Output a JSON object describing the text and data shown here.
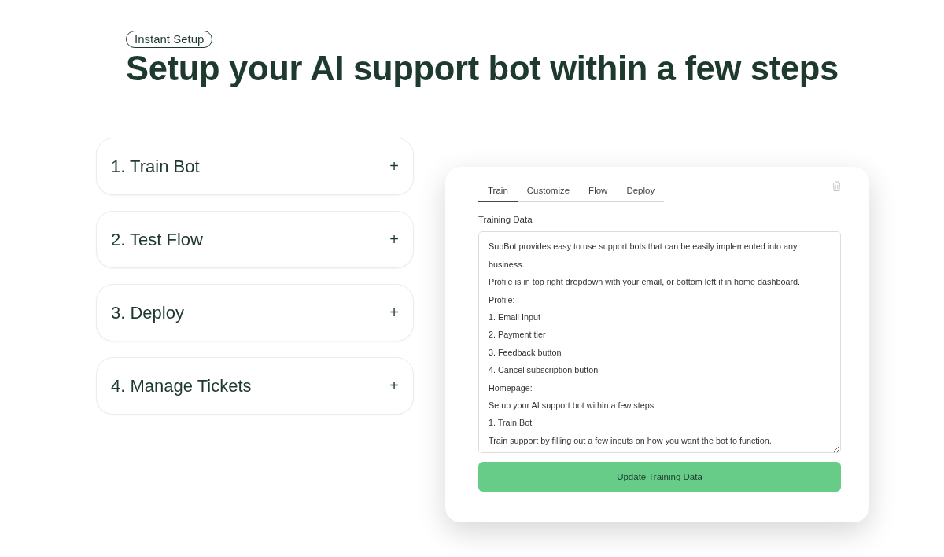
{
  "header": {
    "badge": "Instant Setup",
    "title": "Setup your AI support bot within a few steps"
  },
  "steps": [
    {
      "label": "1. Train Bot",
      "toggle": "+"
    },
    {
      "label": "2. Test Flow",
      "toggle": "+"
    },
    {
      "label": "3. Deploy",
      "toggle": "+"
    },
    {
      "label": "4. Manage Tickets",
      "toggle": "+"
    }
  ],
  "editor": {
    "tabs": [
      {
        "label": "Train",
        "selected": true
      },
      {
        "label": "Customize",
        "selected": false
      },
      {
        "label": "Flow",
        "selected": false
      },
      {
        "label": "Deploy",
        "selected": false
      }
    ],
    "field_label": "Training Data",
    "training_data": [
      "SupBot provides easy to use support bots that can be easily implemented into any business.",
      "Profile is in top right dropdown with your email, or bottom left if in home dashboard.",
      "Profile:",
      "1. Email Input",
      "2. Payment tier",
      "3. Feedback button",
      "4. Cancel subscription button",
      "Homepage:",
      "Setup your AI support bot within a few steps",
      "1. Train Bot",
      "Train support by filling out a few inputs on how you want the bot to function."
    ],
    "button": "Update Training Data"
  }
}
